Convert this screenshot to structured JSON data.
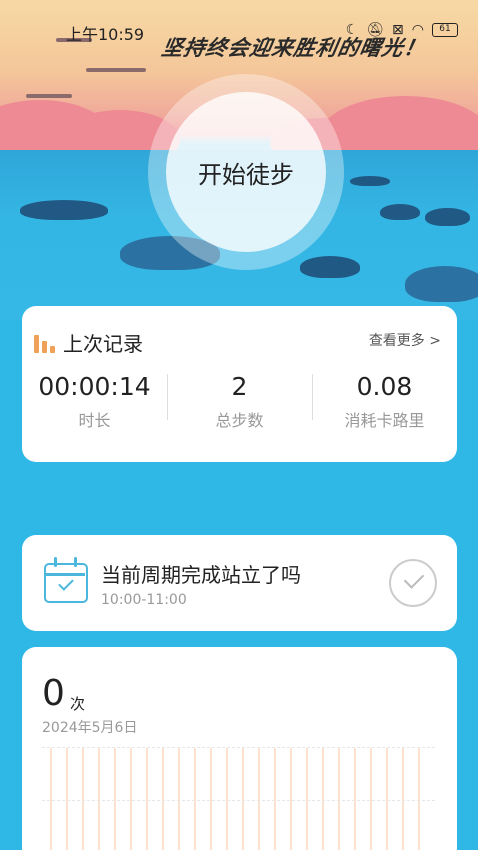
{
  "status": {
    "time": "上午10:59",
    "battery": "61"
  },
  "banner": {
    "slogan": "坚持终会迎来胜利的曙光！",
    "start_label": "开始徒步"
  },
  "record": {
    "title": "上次记录",
    "more_label": "查看更多 >",
    "stats": [
      {
        "value": "00:00:14",
        "label": "时长"
      },
      {
        "value": "2",
        "label": "总步数"
      },
      {
        "value": "0.08",
        "label": "消耗卡路里"
      }
    ]
  },
  "task": {
    "title": "当前周期完成站立了吗",
    "time_range": "10:00-11:00"
  },
  "count": {
    "value": "0",
    "unit": "次",
    "date": "2024年5月6日"
  },
  "colors": {
    "accent": "#2fb7e6",
    "bars": "#f0a25a",
    "calendar": "#4bb7dd"
  }
}
